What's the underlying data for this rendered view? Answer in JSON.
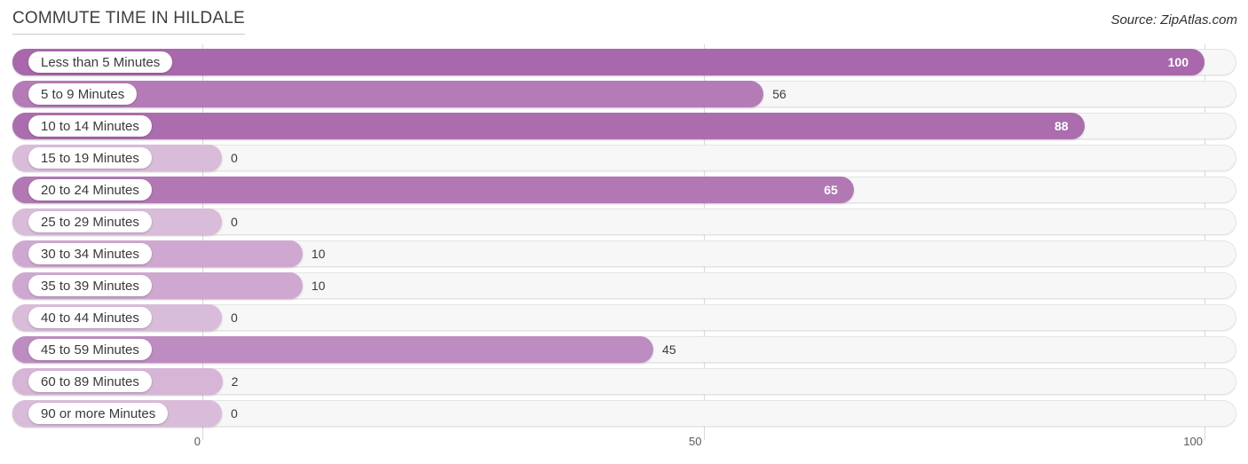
{
  "header": {
    "title": "COMMUTE TIME IN HILDALE",
    "source": "Source: ZipAtlas.com"
  },
  "chart_data": {
    "type": "bar",
    "orientation": "horizontal",
    "title": "COMMUTE TIME IN HILDALE",
    "xlabel": "",
    "ylabel": "",
    "xlim": [
      0,
      100
    ],
    "grid": true,
    "legend": "none",
    "axis_ticks": [
      {
        "label": "0",
        "value": 0
      },
      {
        "label": "50",
        "value": 50
      },
      {
        "label": "100",
        "value": 100
      }
    ],
    "categories": [
      "Less than 5 Minutes",
      "5 to 9 Minutes",
      "10 to 14 Minutes",
      "15 to 19 Minutes",
      "20 to 24 Minutes",
      "25 to 29 Minutes",
      "30 to 34 Minutes",
      "35 to 39 Minutes",
      "40 to 44 Minutes",
      "45 to 59 Minutes",
      "60 to 89 Minutes",
      "90 or more Minutes"
    ],
    "values": [
      100,
      56,
      88,
      0,
      65,
      0,
      10,
      10,
      0,
      45,
      2,
      0
    ],
    "value_labels": [
      "100",
      "56",
      "88",
      "0",
      "65",
      "0",
      "10",
      "10",
      "0",
      "45",
      "2",
      "0"
    ],
    "colors": {
      "bar_high": "#a868ab",
      "bar_mid": "#b87fba",
      "bar_low": "#d2aed3",
      "track": "#f7f7f7",
      "gridline": "#d8d8d8",
      "text": "#3a3a3c"
    }
  },
  "rows": [
    {
      "label": "Less than 5 Minutes",
      "value": 100,
      "value_label": "100",
      "bar_color": "#a868ab",
      "label_inside": true
    },
    {
      "label": "5 to 9 Minutes",
      "value": 56,
      "value_label": "56",
      "bar_color": "#b47bb7",
      "label_inside": false
    },
    {
      "label": "10 to 14 Minutes",
      "value": 88,
      "value_label": "88",
      "bar_color": "#ab6dae",
      "label_inside": true
    },
    {
      "label": "15 to 19 Minutes",
      "value": 0,
      "value_label": "0",
      "bar_color": "#d9bcd9",
      "label_inside": false
    },
    {
      "label": "20 to 24 Minutes",
      "value": 65,
      "value_label": "65",
      "bar_color": "#b178b4",
      "label_inside": true
    },
    {
      "label": "25 to 29 Minutes",
      "value": 0,
      "value_label": "0",
      "bar_color": "#d9bcd9",
      "label_inside": false
    },
    {
      "label": "30 to 34 Minutes",
      "value": 10,
      "value_label": "10",
      "bar_color": "#cfa8d1",
      "label_inside": false
    },
    {
      "label": "35 to 39 Minutes",
      "value": 10,
      "value_label": "10",
      "bar_color": "#cfa8d1",
      "label_inside": false
    },
    {
      "label": "40 to 44 Minutes",
      "value": 0,
      "value_label": "0",
      "bar_color": "#d9bcd9",
      "label_inside": false
    },
    {
      "label": "45 to 59 Minutes",
      "value": 45,
      "value_label": "45",
      "bar_color": "#bd8cc0",
      "label_inside": false
    },
    {
      "label": "60 to 89 Minutes",
      "value": 2,
      "value_label": "2",
      "bar_color": "#d6b5d7",
      "label_inside": false
    },
    {
      "label": "90 or more Minutes",
      "value": 0,
      "value_label": "0",
      "bar_color": "#d9bcd9",
      "label_inside": false
    }
  ]
}
